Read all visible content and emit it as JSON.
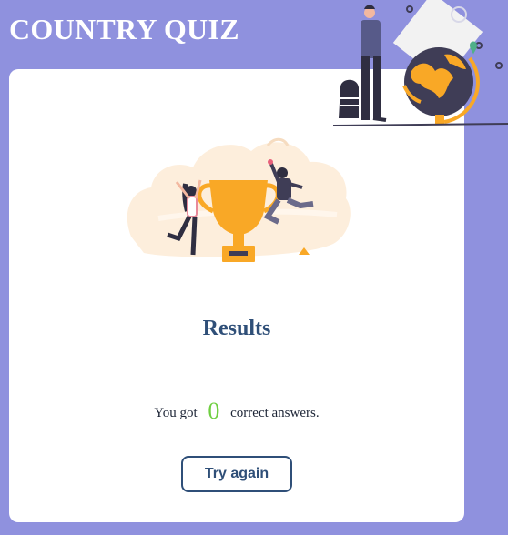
{
  "app": {
    "title": "COUNTRY QUIZ"
  },
  "result": {
    "heading": "Results",
    "text_before": "You got",
    "score": "0",
    "text_after": "correct answers."
  },
  "actions": {
    "try_again_label": "Try again"
  },
  "colors": {
    "background": "#8f91de",
    "card": "#ffffff",
    "heading": "#2f4f78",
    "score": "#6fcf41",
    "accent": "#f9a826"
  },
  "illustrations": [
    "traveler-with-globe-illustration",
    "winners-trophy-illustration"
  ]
}
